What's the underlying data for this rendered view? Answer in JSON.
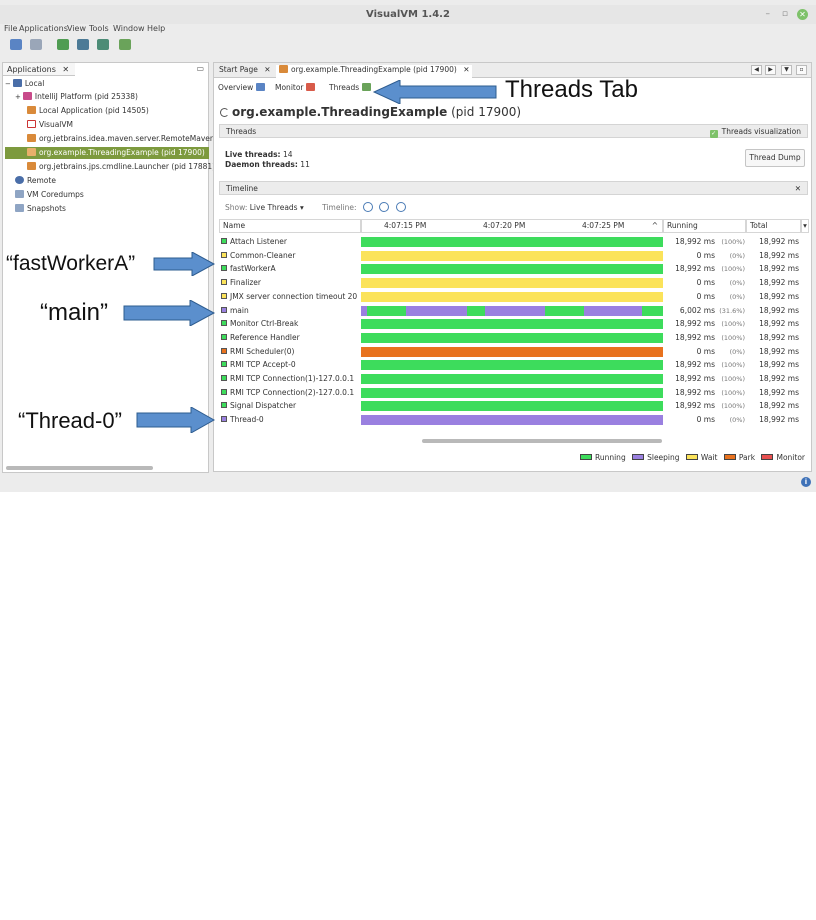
{
  "window": {
    "title": "VisualVM 1.4.2",
    "minimize": "–",
    "restore": "▫",
    "close": "✕"
  },
  "menu": [
    "File",
    "Applications",
    "View",
    "Tools",
    "Window",
    "Help"
  ],
  "left_panel": {
    "tab_label": "Applications",
    "tab_close": "✕",
    "tree": [
      {
        "label": "Local",
        "expander": "−"
      },
      {
        "label": "IntelliJ Platform (pid 25338)",
        "expander": "+"
      },
      {
        "label": "Local Application (pid 14505)"
      },
      {
        "label": "VisualVM"
      },
      {
        "label": "org.jetbrains.idea.maven.server.RemoteMavenServer36 (pid 40"
      },
      {
        "label": "org.example.ThreadingExample (pid 17900)"
      },
      {
        "label": "org.jetbrains.jps.cmdline.Launcher (pid 17881)"
      },
      {
        "label": "Remote"
      },
      {
        "label": "VM Coredumps"
      },
      {
        "label": "Snapshots"
      }
    ]
  },
  "doc_tabs": [
    {
      "label": "Start Page",
      "close": "✕"
    },
    {
      "label": "org.example.ThreadingExample (pid 17900)",
      "close": "✕"
    }
  ],
  "sub_tabs": [
    "Overview",
    "Monitor",
    "Threads"
  ],
  "process_title": {
    "name": "org.example.ThreadingExample",
    "pid": "(pid 17900)"
  },
  "threads_section": {
    "label": "Threads",
    "visualization_label": "Threads visualization",
    "live_label": "Live threads:",
    "live_value": "14",
    "daemon_label": "Daemon threads:",
    "daemon_value": "11",
    "dump_button": "Thread Dump"
  },
  "timeline_section": {
    "label": "Timeline",
    "close": "✕",
    "show_label": "Show:",
    "show_value": "Live Threads ▾",
    "timeline_label": "Timeline:"
  },
  "columns": {
    "name": "Name",
    "times": [
      "4:07:15 PM",
      "4:07:20 PM",
      "4:07:25 PM"
    ],
    "running": "Running",
    "total": "Total"
  },
  "threads": [
    {
      "name": "Attach Listener",
      "state": "running",
      "running": "18,992 ms",
      "pct": "(100%)",
      "total": "18,992 ms"
    },
    {
      "name": "Common-Cleaner",
      "state": "wait",
      "running": "0 ms",
      "pct": "(0%)",
      "total": "18,992 ms"
    },
    {
      "name": "fastWorkerA",
      "state": "running",
      "running": "18,992 ms",
      "pct": "(100%)",
      "total": "18,992 ms"
    },
    {
      "name": "Finalizer",
      "state": "wait",
      "running": "0 ms",
      "pct": "(0%)",
      "total": "18,992 ms"
    },
    {
      "name": "JMX server connection timeout 20",
      "state": "wait",
      "running": "0 ms",
      "pct": "(0%)",
      "total": "18,992 ms"
    },
    {
      "name": "main",
      "state": "sleeping",
      "running": "6,002 ms",
      "pct": "(31.6%)",
      "total": "18,992 ms"
    },
    {
      "name": "Monitor Ctrl-Break",
      "state": "running",
      "running": "18,992 ms",
      "pct": "(100%)",
      "total": "18,992 ms"
    },
    {
      "name": "Reference Handler",
      "state": "running",
      "running": "18,992 ms",
      "pct": "(100%)",
      "total": "18,992 ms"
    },
    {
      "name": "RMI Scheduler(0)",
      "state": "park",
      "running": "0 ms",
      "pct": "(0%)",
      "total": "18,992 ms"
    },
    {
      "name": "RMI TCP Accept-0",
      "state": "running",
      "running": "18,992 ms",
      "pct": "(100%)",
      "total": "18,992 ms"
    },
    {
      "name": "RMI TCP Connection(1)-127.0.0.1",
      "state": "running",
      "running": "18,992 ms",
      "pct": "(100%)",
      "total": "18,992 ms"
    },
    {
      "name": "RMI TCP Connection(2)-127.0.0.1",
      "state": "running",
      "running": "18,992 ms",
      "pct": "(100%)",
      "total": "18,992 ms"
    },
    {
      "name": "Signal Dispatcher",
      "state": "running",
      "running": "18,992 ms",
      "pct": "(100%)",
      "total": "18,992 ms"
    },
    {
      "name": "Thread-0",
      "state": "sleeping",
      "running": "0 ms",
      "pct": "(0%)",
      "total": "18,992 ms"
    }
  ],
  "legend": [
    {
      "label": "Running",
      "color": "#3ddc5c"
    },
    {
      "label": "Sleeping",
      "color": "#9a80e0"
    },
    {
      "label": "Wait",
      "color": "#fbe35a"
    },
    {
      "label": "Park",
      "color": "#e8721e"
    },
    {
      "label": "Monitor",
      "color": "#e85050"
    }
  ],
  "state_colors": {
    "running": "#3ddc5c",
    "sleeping": "#9a80e0",
    "wait": "#fbe35a",
    "park": "#e8721e",
    "monitor": "#e85050"
  },
  "annotations": [
    {
      "text": "Threads Tab"
    },
    {
      "text": "“fastWorkerA”"
    },
    {
      "text": "“main”"
    },
    {
      "text": "“Thread-0”"
    }
  ],
  "status": {
    "info_icon": "i"
  }
}
